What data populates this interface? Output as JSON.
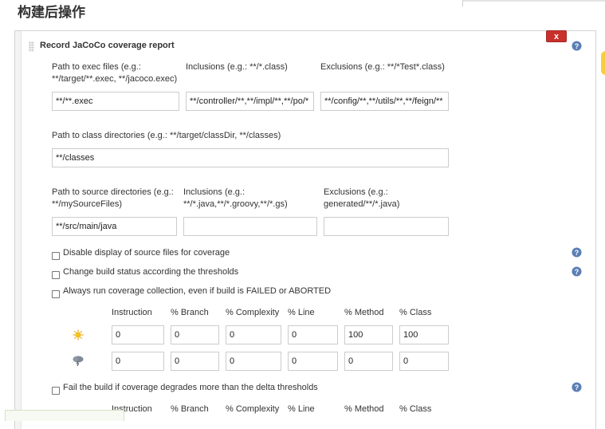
{
  "section": {
    "title": "构建后操作"
  },
  "panel": {
    "title": "Record JaCoCo coverage report",
    "delete_label": "x"
  },
  "exec": {
    "label_line1": "Path to exec files (e.g.:",
    "label_line2": "**/target/**.exec, **/jacoco.exec)",
    "value": "**/**.exec"
  },
  "inclusions": {
    "label": "Inclusions (e.g.: **/*.class)",
    "value": "**/controller/**,**/impl/**,**/po/*"
  },
  "exclusions": {
    "label": "Exclusions (e.g.: **/*Test*.class)",
    "value": "**/config/**,**/utils/**,**/feign/**"
  },
  "class_dirs": {
    "label": "Path to class directories (e.g.: **/target/classDir, **/classes)",
    "value": "**/classes"
  },
  "source_dirs": {
    "label_line1": "Path to source directories (e.g.:",
    "label_line2": "**/mySourceFiles)",
    "value": "**/src/main/java"
  },
  "source_inclusions": {
    "label_line1": "Inclusions (e.g.:",
    "label_line2": "**/*.java,**/*.groovy,**/*.gs)",
    "value": ""
  },
  "source_exclusions": {
    "label_line1": "Exclusions (e.g.:",
    "label_line2": "generated/**/*.java)",
    "value": ""
  },
  "checkboxes": {
    "disable_source": "Disable display of source files for coverage",
    "change_status": "Change build status according the thresholds",
    "always_run": "Always run coverage collection, even if build is FAILED or ABORTED",
    "fail_delta": "Fail the build if coverage degrades more than the delta thresholds"
  },
  "thresholds": {
    "headers": [
      "Instruction",
      "% Branch",
      "% Complexity",
      "% Line",
      "% Method",
      "% Class"
    ],
    "sunny": [
      "0",
      "0",
      "0",
      "0",
      "100",
      "100"
    ],
    "stormy": [
      "0",
      "0",
      "0",
      "0",
      "0",
      "0"
    ]
  },
  "delta_headers": [
    "Instruction",
    "% Branch",
    "% Complexity",
    "% Line",
    "% Method",
    "% Class"
  ],
  "icons": {
    "help": "help-icon",
    "sunny": "sunny-weather-icon",
    "stormy": "stormy-weather-icon",
    "grip": "drag-handle-icon"
  },
  "colors": {
    "delete": "#c9302c",
    "help": "#5a7fb5",
    "sun": "#f5c518"
  }
}
